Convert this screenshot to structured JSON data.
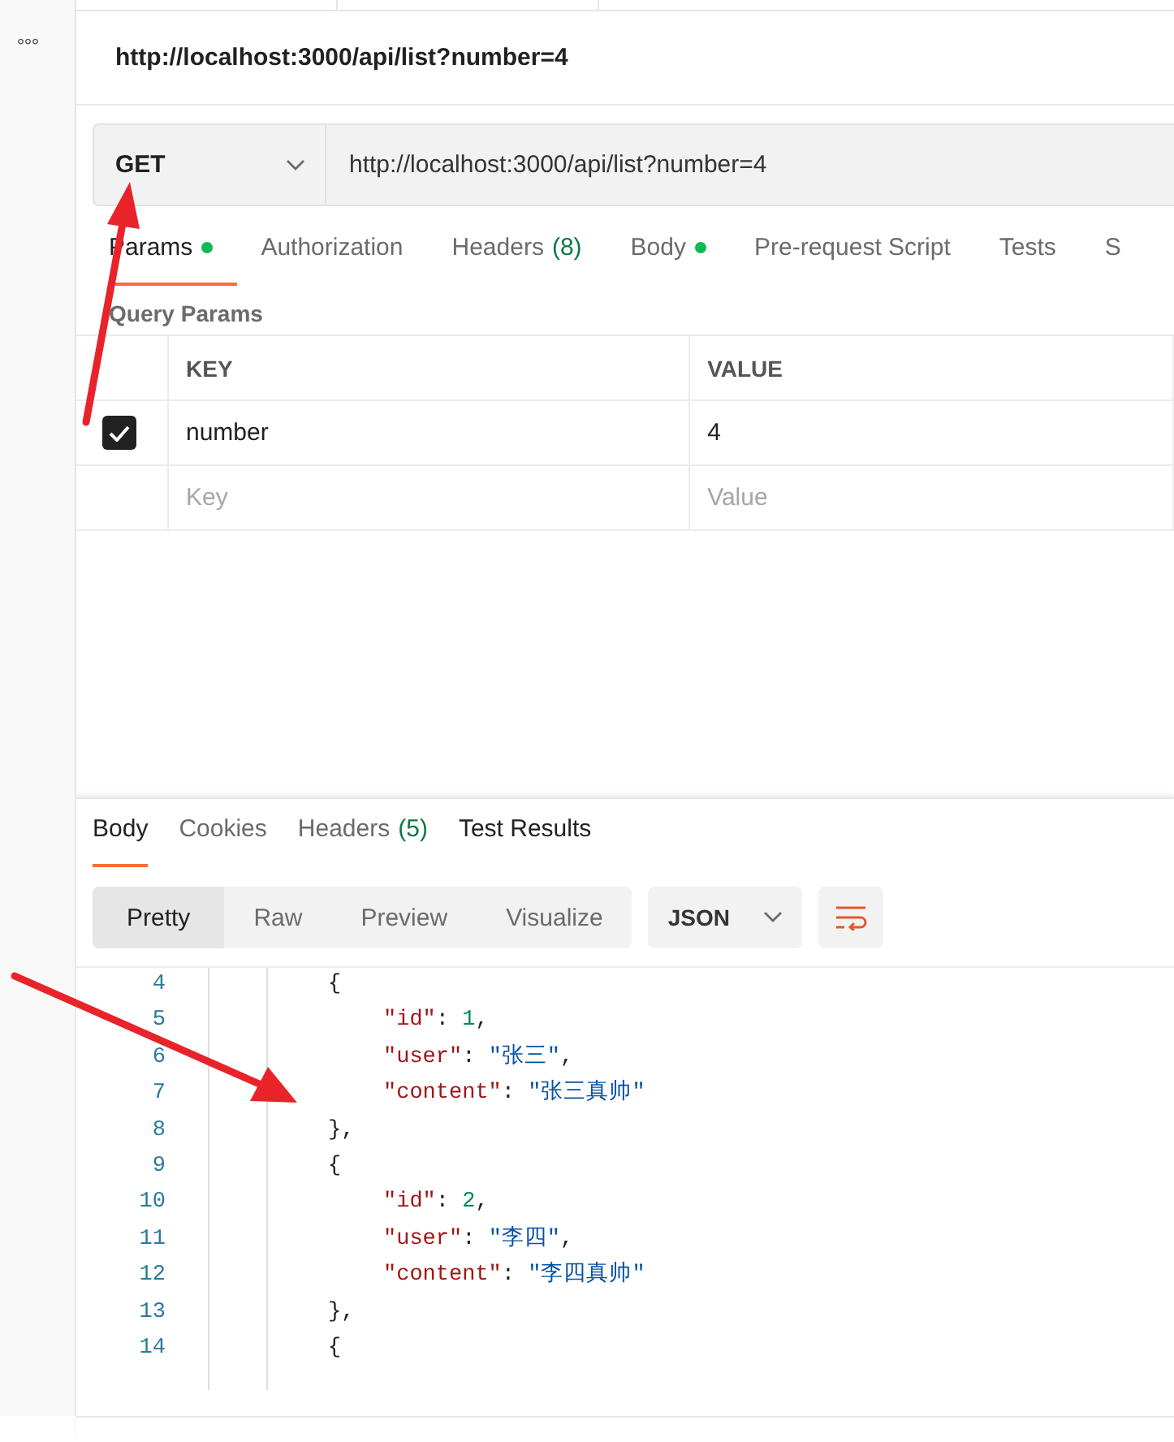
{
  "sidebar": {
    "more": "°°°"
  },
  "request_title": "http://localhost:3000/api/list?number=4",
  "request": {
    "method": "GET",
    "url": "http://localhost:3000/api/list?number=4"
  },
  "request_tabs": [
    {
      "label": "Params",
      "dot": true,
      "selected": true
    },
    {
      "label": "Authorization",
      "dot": false,
      "selected": false
    },
    {
      "label": "Headers",
      "count": "(8)",
      "dot": false,
      "selected": false
    },
    {
      "label": "Body",
      "dot": true,
      "selected": false
    },
    {
      "label": "Pre-request Script",
      "dot": false,
      "selected": false
    },
    {
      "label": "Tests",
      "dot": false,
      "selected": false
    },
    {
      "label": "S",
      "dot": false,
      "selected": false
    }
  ],
  "params": {
    "title": "Query Params",
    "columns": [
      "KEY",
      "VALUE"
    ],
    "rows": [
      {
        "key": "number",
        "value": "4",
        "checked": true
      }
    ],
    "new_row": {
      "key_placeholder": "Key",
      "value_placeholder": "Value"
    }
  },
  "response_tabs": [
    {
      "label": "Body",
      "selected": true
    },
    {
      "label": "Cookies",
      "selected": false
    },
    {
      "label": "Headers",
      "count": "(5)",
      "selected": false
    },
    {
      "label": "Test Results",
      "selected": false
    }
  ],
  "view_modes": [
    {
      "label": "Pretty",
      "selected": true
    },
    {
      "label": "Raw",
      "selected": false
    },
    {
      "label": "Preview",
      "selected": false
    },
    {
      "label": "Visualize",
      "selected": false
    }
  ],
  "format": "JSON",
  "code_lines": [
    {
      "number": "4",
      "kind": "brace",
      "tokens": [
        {
          "kind": "punct",
          "text": "{"
        }
      ]
    },
    {
      "number": "5",
      "kind": "member",
      "tokens": [
        {
          "kind": "key",
          "text": "\"id\""
        },
        {
          "kind": "punct",
          "text": ": "
        },
        {
          "kind": "number",
          "text": "1"
        },
        {
          "kind": "punct",
          "text": ","
        }
      ]
    },
    {
      "number": "6",
      "kind": "member",
      "tokens": [
        {
          "kind": "key",
          "text": "\"user\""
        },
        {
          "kind": "punct",
          "text": ": "
        },
        {
          "kind": "string",
          "text": "\"张三\""
        },
        {
          "kind": "punct",
          "text": ","
        }
      ]
    },
    {
      "number": "7",
      "kind": "member",
      "tokens": [
        {
          "kind": "key",
          "text": "\"content\""
        },
        {
          "kind": "punct",
          "text": ": "
        },
        {
          "kind": "string",
          "text": "\"张三真帅\""
        }
      ]
    },
    {
      "number": "8",
      "kind": "brace",
      "tokens": [
        {
          "kind": "punct",
          "text": "},"
        }
      ]
    },
    {
      "number": "9",
      "kind": "brace",
      "tokens": [
        {
          "kind": "punct",
          "text": "{"
        }
      ]
    },
    {
      "number": "10",
      "kind": "member",
      "tokens": [
        {
          "kind": "key",
          "text": "\"id\""
        },
        {
          "kind": "punct",
          "text": ": "
        },
        {
          "kind": "number",
          "text": "2"
        },
        {
          "kind": "punct",
          "text": ","
        }
      ]
    },
    {
      "number": "11",
      "kind": "member",
      "tokens": [
        {
          "kind": "key",
          "text": "\"user\""
        },
        {
          "kind": "punct",
          "text": ": "
        },
        {
          "kind": "string",
          "text": "\"李四\""
        },
        {
          "kind": "punct",
          "text": ","
        }
      ]
    },
    {
      "number": "12",
      "kind": "member",
      "tokens": [
        {
          "kind": "key",
          "text": "\"content\""
        },
        {
          "kind": "punct",
          "text": ": "
        },
        {
          "kind": "string",
          "text": "\"李四真帅\""
        }
      ]
    },
    {
      "number": "13",
      "kind": "brace",
      "tokens": [
        {
          "kind": "punct",
          "text": "},"
        }
      ]
    },
    {
      "number": "14",
      "kind": "brace",
      "tokens": [
        {
          "kind": "punct",
          "text": "{"
        }
      ]
    }
  ]
}
